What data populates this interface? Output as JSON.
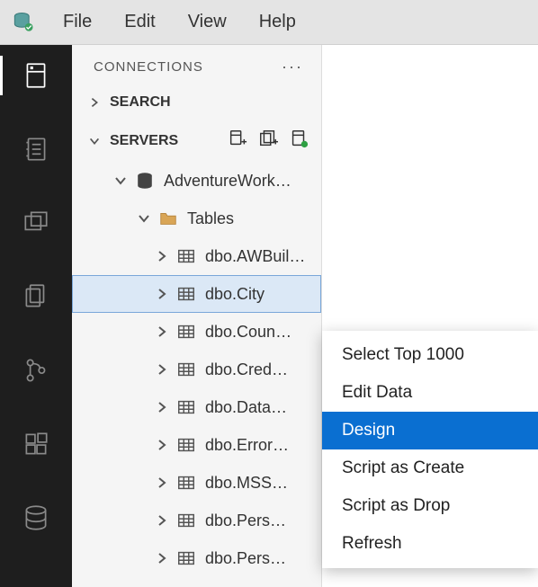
{
  "menubar": {
    "items": [
      "File",
      "Edit",
      "View",
      "Help"
    ]
  },
  "panel": {
    "title": "CONNECTIONS",
    "sections": {
      "search": {
        "label": "SEARCH"
      },
      "servers": {
        "label": "SERVERS"
      }
    }
  },
  "tree": {
    "database": "AdventureWork…",
    "folder": "Tables",
    "tables": [
      "dbo.AWBuil…",
      "dbo.City",
      "dbo.Coun…",
      "dbo.Cred…",
      "dbo.Data…",
      "dbo.Error…",
      "dbo.MSS…",
      "dbo.Pers…",
      "dbo.Pers…"
    ],
    "selectedIndex": 1
  },
  "contextMenu": {
    "items": [
      "Select Top 1000",
      "Edit Data",
      "Design",
      "Script as Create",
      "Script as Drop",
      "Refresh"
    ],
    "hoverIndex": 2
  }
}
